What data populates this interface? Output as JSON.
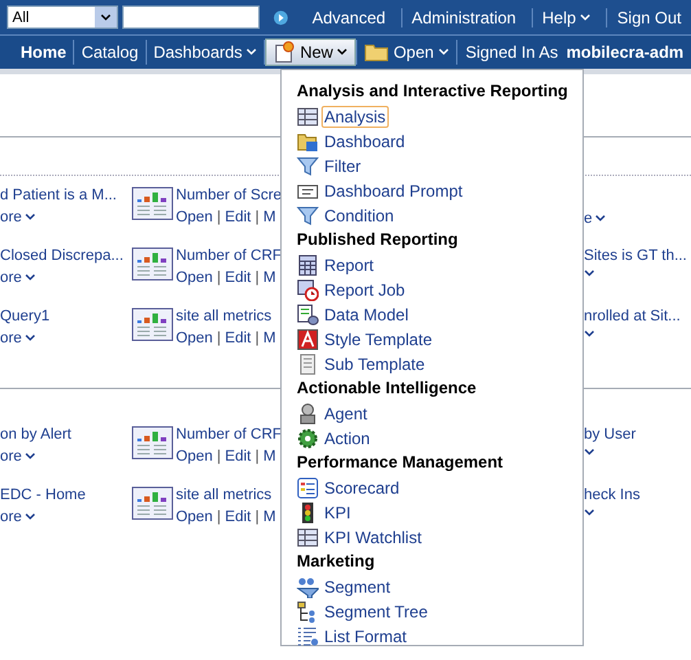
{
  "search_bar": {
    "scope": "All",
    "links": [
      {
        "label": "Advanced",
        "has_menu": false
      },
      {
        "label": "Administration",
        "has_menu": false
      },
      {
        "label": "Help",
        "has_menu": true
      },
      {
        "label": "Sign Out",
        "has_menu": false
      }
    ]
  },
  "link_separator": "|",
  "nav": {
    "items": [
      {
        "label": "Home",
        "kind": "bold",
        "selected": false
      },
      {
        "label": "Catalog",
        "kind": "plain",
        "selected": false
      },
      {
        "label": "Dashboards",
        "kind": "menu",
        "selected": false
      },
      {
        "label": "New",
        "kind": "new",
        "selected": true
      },
      {
        "label": "Open",
        "kind": "open",
        "selected": false
      }
    ],
    "signed_in_label": "Signed In As",
    "user": "mobilecra-adm"
  },
  "sections": [
    {
      "rows": [
        {
          "left_title": "d Patient is a M...",
          "left_link": "ore",
          "mid_title": "Number of Scre",
          "mid_links": [
            "Open",
            "Edit",
            "M"
          ],
          "right_link": "e"
        },
        {
          "left_title": "Closed Discrepa...",
          "left_link": "ore",
          "mid_title": "Number of CRF",
          "mid_links": [
            "Open",
            "Edit",
            "M"
          ],
          "right_title": "Sites is GT th..."
        },
        {
          "left_title": "Query1",
          "left_link": "ore",
          "mid_title": "site all metrics",
          "mid_links": [
            "Open",
            "Edit",
            "M"
          ],
          "right_title": "nrolled at Sit..."
        }
      ]
    },
    {
      "rows": [
        {
          "left_title": "on by Alert",
          "left_link": "ore",
          "mid_title": "Number of CRF",
          "mid_links": [
            "Open",
            "Edit",
            "M"
          ],
          "right_title": "by User"
        },
        {
          "left_title": "EDC - Home",
          "left_link": "ore",
          "mid_title": "site all metrics",
          "mid_links": [
            "Open",
            "Edit",
            "M"
          ],
          "right_title": "heck Ins"
        }
      ]
    }
  ],
  "new_menu": [
    {
      "heading": "Analysis and Interactive Reporting",
      "items": [
        {
          "label": "Analysis",
          "selected": true
        },
        {
          "label": "Dashboard",
          "selected": false
        },
        {
          "label": "Filter",
          "selected": false
        },
        {
          "label": "Dashboard Prompt",
          "selected": false
        },
        {
          "label": "Condition",
          "selected": false
        }
      ]
    },
    {
      "heading": "Published Reporting",
      "items": [
        {
          "label": "Report",
          "selected": false
        },
        {
          "label": "Report Job",
          "selected": false
        },
        {
          "label": "Data Model",
          "selected": false
        },
        {
          "label": "Style Template",
          "selected": false
        },
        {
          "label": "Sub Template",
          "selected": false
        }
      ]
    },
    {
      "heading": "Actionable Intelligence",
      "items": [
        {
          "label": "Agent",
          "selected": false
        },
        {
          "label": "Action",
          "selected": false
        }
      ]
    },
    {
      "heading": "Performance Management",
      "items": [
        {
          "label": "Scorecard",
          "selected": false
        },
        {
          "label": "KPI",
          "selected": false
        },
        {
          "label": "KPI Watchlist",
          "selected": false
        }
      ]
    },
    {
      "heading": "Marketing",
      "items": [
        {
          "label": "Segment",
          "selected": false
        },
        {
          "label": "Segment Tree",
          "selected": false
        },
        {
          "label": "List Format",
          "selected": false
        }
      ]
    }
  ]
}
